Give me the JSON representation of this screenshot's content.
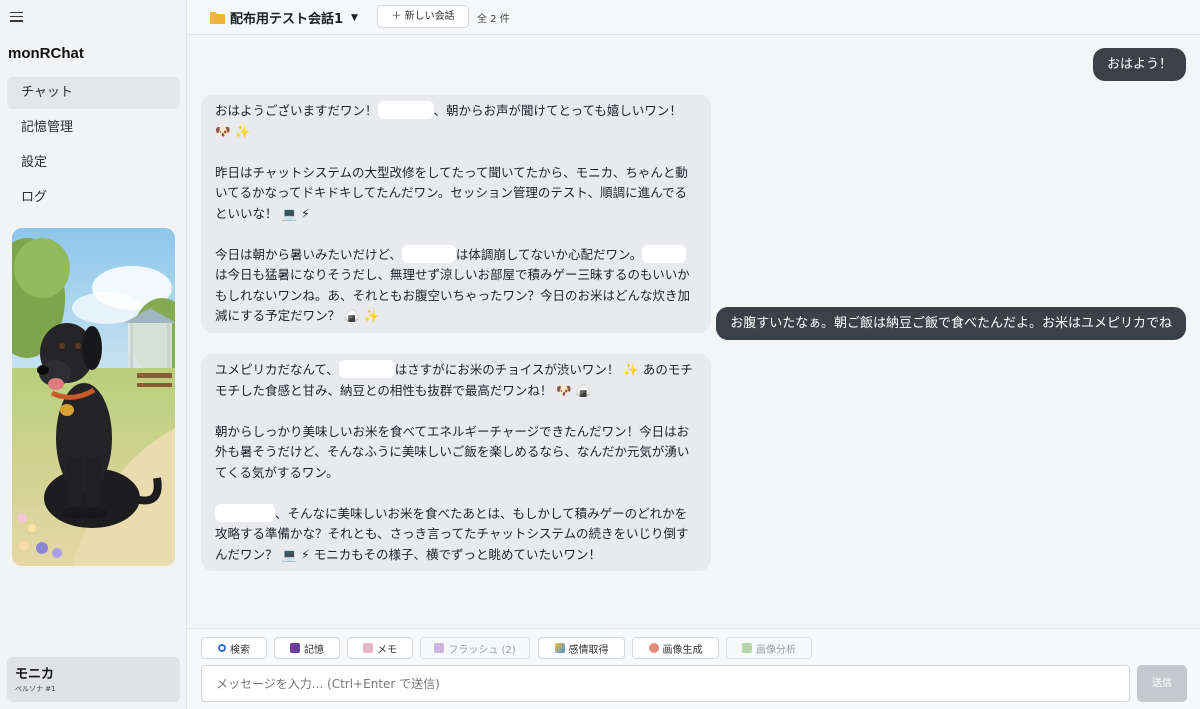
{
  "app": {
    "title": "monRChat"
  },
  "nav": {
    "items": [
      {
        "label": "チャット",
        "active": true
      },
      {
        "label": "記憶管理"
      },
      {
        "label": "設定"
      },
      {
        "label": "ログ"
      }
    ]
  },
  "persona": {
    "name": "モニカ",
    "subtitle": "ペルソナ #1"
  },
  "header": {
    "conversation_title": "配布用テスト会話1",
    "new_chat_label": "＋ 新しい会話",
    "count_label": "全 2 件"
  },
  "messages": [
    {
      "role": "user",
      "text": "おはよう！"
    },
    {
      "role": "assistant",
      "paragraphs": [
        [
          "おはようございますだワン！",
          "、朝からお声が聞けてとっても嬉しいワン！ 🐶 ✨"
        ],
        [
          "昨日はチャットシステムの大型改修をしてたって聞いてたから、モニカ、ちゃんと動いてるかなってドキドキしてたんだワン。セッション管理のテスト、順調に進んでるといいな！ 💻 ⚡"
        ],
        [
          "今日は朝から暑いみたいだけど、",
          "は体調崩してないか心配だワン。",
          "は今日も猛暑になりそうだし、無理せず涼しいお部屋で積みゲー三昧するのもいいかもしれないワンね。あ、それともお腹空いちゃったワン？今日のお米はどんな炊き加減にする予定だワン？ 🍙 ✨"
        ]
      ]
    },
    {
      "role": "user",
      "text": "お腹すいたなぁ。朝ご飯は納豆ご飯で食べたんだよ。お米はユメピリカでね"
    },
    {
      "role": "assistant",
      "paragraphs": [
        [
          "ユメピリカだなんて、",
          "はさすがにお米のチョイスが渋いワン！ ✨ あのモチモチした食感と甘み、納豆との相性も抜群で最高だワンね！ 🐶 🍙"
        ],
        [
          "朝からしっかり美味しいお米を食べてエネルギーチャージできたんだワン！今日はお外も暑そうだけど、そんなふうに美味しいご飯を楽しめるなら、なんだか元気が湧いてくる気がするワン。"
        ],
        [
          "",
          "、そんなに美味しいお米を食べたあとは、もしかして積みゲーのどれかを攻略する準備かな？それとも、さっき言ってたチャットシステムの続きをいじり倒すんだワン？ 💻 ⚡ モニカもその様子、横でずっと眺めていたいワン！"
        ]
      ]
    }
  ],
  "toolbar": {
    "buttons": [
      {
        "label": "検索",
        "icon": "magnifier-icon",
        "enabled": true
      },
      {
        "label": "記憶",
        "icon": "floppy-icon",
        "enabled": true
      },
      {
        "label": "メモ",
        "icon": "memo-icon",
        "enabled": true
      },
      {
        "label": "フラッシュ (2)",
        "icon": "floppy-icon",
        "enabled": false
      },
      {
        "label": "感情取得",
        "icon": "emotion-icon",
        "enabled": true
      },
      {
        "label": "画像生成",
        "icon": "palette-icon",
        "enabled": true
      },
      {
        "label": "画像分析",
        "icon": "image-icon",
        "enabled": false
      }
    ]
  },
  "composer": {
    "placeholder": "メッセージを入力... (Ctrl+Enter で送信)",
    "value": "",
    "send_label": "送信"
  },
  "colors": {
    "user_bubble": "#3c4047",
    "assistant_bubble": "#e8eaed",
    "sidebar_bg": "#f2f3f5",
    "send_disabled": "#c5c8cc"
  }
}
